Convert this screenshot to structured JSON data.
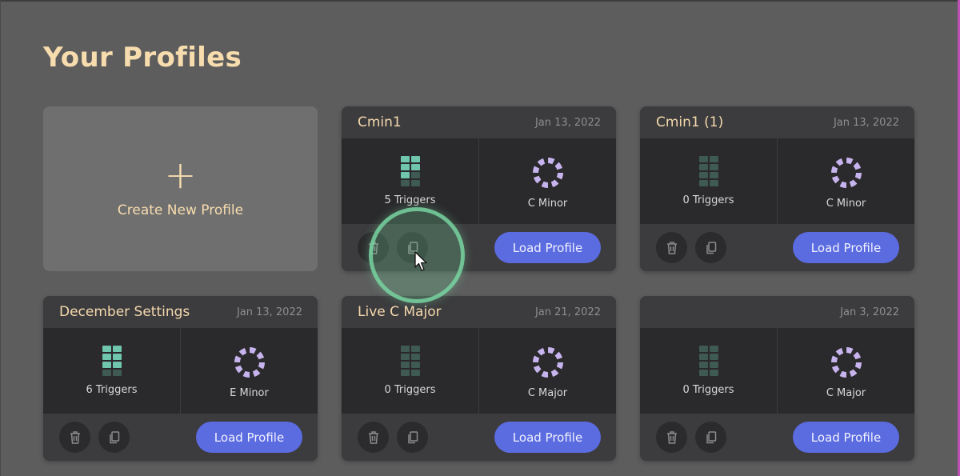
{
  "page": {
    "title": "Your Profiles"
  },
  "create_card": {
    "plus": "+",
    "label": "Create New Profile"
  },
  "colors": {
    "accent": "#5b6be0",
    "title": "#f7dcae",
    "trigger_on": "#6fc6ad",
    "key_ring": "#c7b4ee"
  },
  "profiles": [
    {
      "name": "Cmin1",
      "date": "Jan 13, 2022",
      "triggers": 5,
      "triggers_label": "5 Triggers",
      "key": "C Minor",
      "load_label": "Load Profile"
    },
    {
      "name": "Cmin1 (1)",
      "date": "Jan 13, 2022",
      "triggers": 0,
      "triggers_label": "0 Triggers",
      "key": "C Minor",
      "load_label": "Load Profile"
    },
    {
      "name": "December Settings",
      "date": "Jan 13, 2022",
      "triggers": 6,
      "triggers_label": "6 Triggers",
      "key": "E Minor",
      "load_label": "Load Profile"
    },
    {
      "name": "Live C Major",
      "date": "Jan 21, 2022",
      "triggers": 0,
      "triggers_label": "0 Triggers",
      "key": "C Major",
      "load_label": "Load Profile"
    },
    {
      "name": "",
      "date": "Jan 3, 2022",
      "triggers": 0,
      "triggers_label": "0 Triggers",
      "key": "C Major",
      "load_label": "Load Profile"
    }
  ],
  "icons": {
    "delete": "trash-icon",
    "duplicate": "copy-icon",
    "triggers": "grid-icon",
    "key": "ring-icon"
  }
}
